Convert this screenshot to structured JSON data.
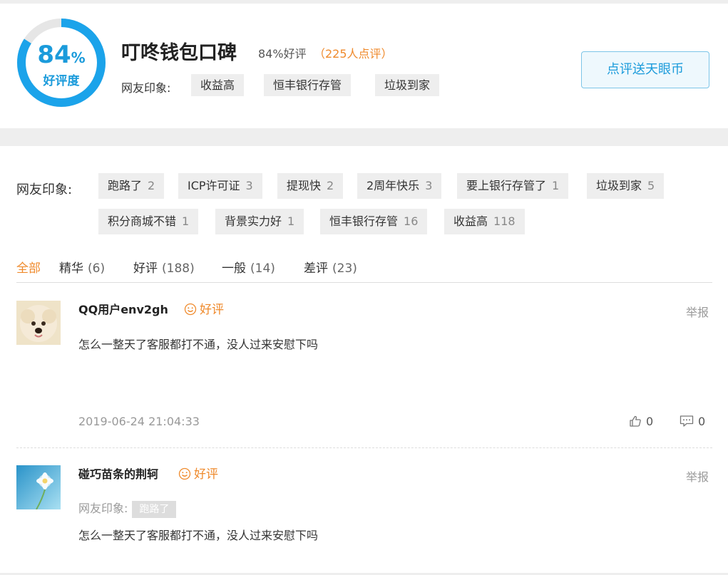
{
  "header": {
    "score_value": "84",
    "score_sign": "%",
    "score_fraction": 0.84,
    "score_label": "好评度",
    "title": "叮咚钱包口碑",
    "positive_rate": "84%好评",
    "review_count": "（225人点评）",
    "impression_label": "网友印象:",
    "impressions": [
      "收益高",
      "恒丰银行存管",
      "垃圾到家"
    ],
    "cta_label": "点评送天眼币"
  },
  "impressions": {
    "label": "网友印象:",
    "tags": [
      {
        "label": "跑路了",
        "count": "2"
      },
      {
        "label": "ICP许可证",
        "count": "3"
      },
      {
        "label": "提现快",
        "count": "2"
      },
      {
        "label": "2周年快乐",
        "count": "3"
      },
      {
        "label": "要上银行存管了",
        "count": "1"
      },
      {
        "label": "垃圾到家",
        "count": "5"
      },
      {
        "label": "积分商城不错",
        "count": "1"
      },
      {
        "label": "背景实力好",
        "count": "1"
      },
      {
        "label": "恒丰银行存管",
        "count": "16"
      },
      {
        "label": "收益高",
        "count": "118"
      }
    ]
  },
  "filters": [
    {
      "label": "全部",
      "count": ""
    },
    {
      "label": "精华",
      "count": "(6)"
    },
    {
      "label": "好评",
      "count": "(188)"
    },
    {
      "label": "一般",
      "count": "(14)"
    },
    {
      "label": "差评",
      "count": "(23)"
    }
  ],
  "reviews": [
    {
      "user": "QQ用户env2gh",
      "sentiment": "好评",
      "report": "举报",
      "content": "怎么一整天了客服都打不通，没人过来安慰下吗",
      "time": "2019-06-24 21:04:33",
      "likes": "0",
      "comments": "0"
    },
    {
      "user": "碰巧苗条的荆轲",
      "sentiment": "好评",
      "report": "举报",
      "impression_label": "网友印象:",
      "impression_tag": "跑路了",
      "content": "怎么一整天了客服都打不通，没人过来安慰下吗"
    }
  ],
  "colors": {
    "accent_blue": "#1b9bdb",
    "accent_orange": "#ef8a2c",
    "tag_bg": "#eeeeee"
  },
  "icons": [
    "thumbs-up-icon",
    "comment-icon",
    "smile-icon"
  ]
}
